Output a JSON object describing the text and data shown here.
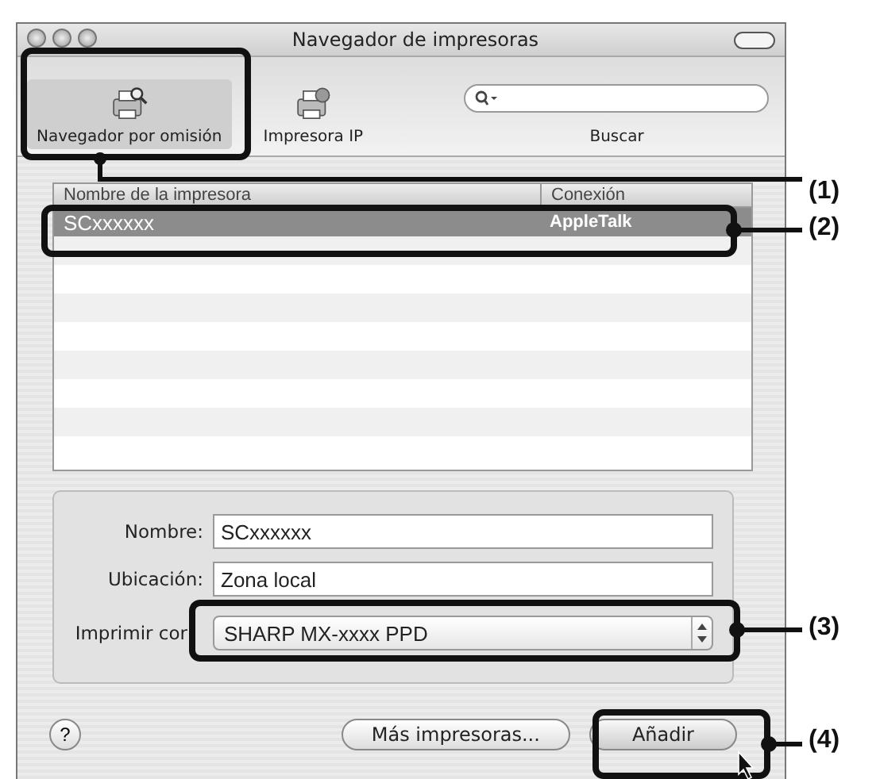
{
  "window": {
    "title": "Navegador de impresoras"
  },
  "toolbar": {
    "items": [
      {
        "label": "Navegador por omisión",
        "selected": true,
        "kind": "browser"
      },
      {
        "label": "Impresora IP",
        "selected": false,
        "kind": "ip"
      }
    ],
    "search": {
      "label": "Buscar"
    }
  },
  "table": {
    "columns": [
      "Nombre de la impresora",
      "Conexión"
    ],
    "rows": [
      {
        "cells": [
          "SCxxxxxx",
          "AppleTalk"
        ],
        "selected": true
      }
    ]
  },
  "form": {
    "fields": [
      {
        "label": "Nombre:",
        "value": "SCxxxxxx"
      },
      {
        "label": "Ubicación:",
        "value": "Zona local"
      }
    ],
    "print_with": {
      "label": "Imprimir cor",
      "value": "SHARP MX-xxxx PPD"
    }
  },
  "help": {
    "label": "?"
  },
  "buttons": [
    {
      "label": "Más impresoras...",
      "kind": "normal"
    },
    {
      "label": "Añadir",
      "kind": "default"
    }
  ],
  "callouts": [
    "(1)",
    "(2)",
    "(3)",
    "(4)"
  ]
}
